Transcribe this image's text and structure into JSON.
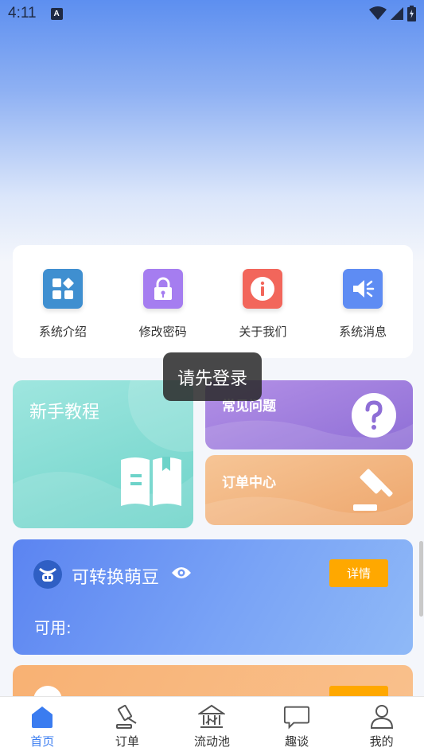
{
  "status_bar": {
    "time": "4:11",
    "notification_icon": "A"
  },
  "quick_menu": [
    {
      "label": "系统介绍",
      "icon": "apps-icon",
      "color": "#3f8fd0"
    },
    {
      "label": "修改密码",
      "icon": "lock-icon",
      "color": "#a57df0"
    },
    {
      "label": "关于我们",
      "icon": "info-icon",
      "color": "#f2665b"
    },
    {
      "label": "系统消息",
      "icon": "speaker-icon",
      "color": "#5e8cf3"
    }
  ],
  "toast": "请先登录",
  "tiles": {
    "tutorial": "新手教程",
    "faq": "常见问题",
    "orders": "订单中心"
  },
  "bean_card": {
    "title": "可转换萌豆",
    "available_label": "可用:",
    "detail_button": "详情"
  },
  "tab_bar": [
    {
      "label": "首页",
      "icon": "home-icon",
      "active": true
    },
    {
      "label": "订单",
      "icon": "gavel-icon",
      "active": false
    },
    {
      "label": "流动池",
      "icon": "bank-icon",
      "active": false
    },
    {
      "label": "趣谈",
      "icon": "chat-icon",
      "active": false
    },
    {
      "label": "我的",
      "icon": "user-icon",
      "active": false
    }
  ],
  "colors": {
    "accent": "#3a7cf0",
    "detail_button": "#ffa800"
  }
}
